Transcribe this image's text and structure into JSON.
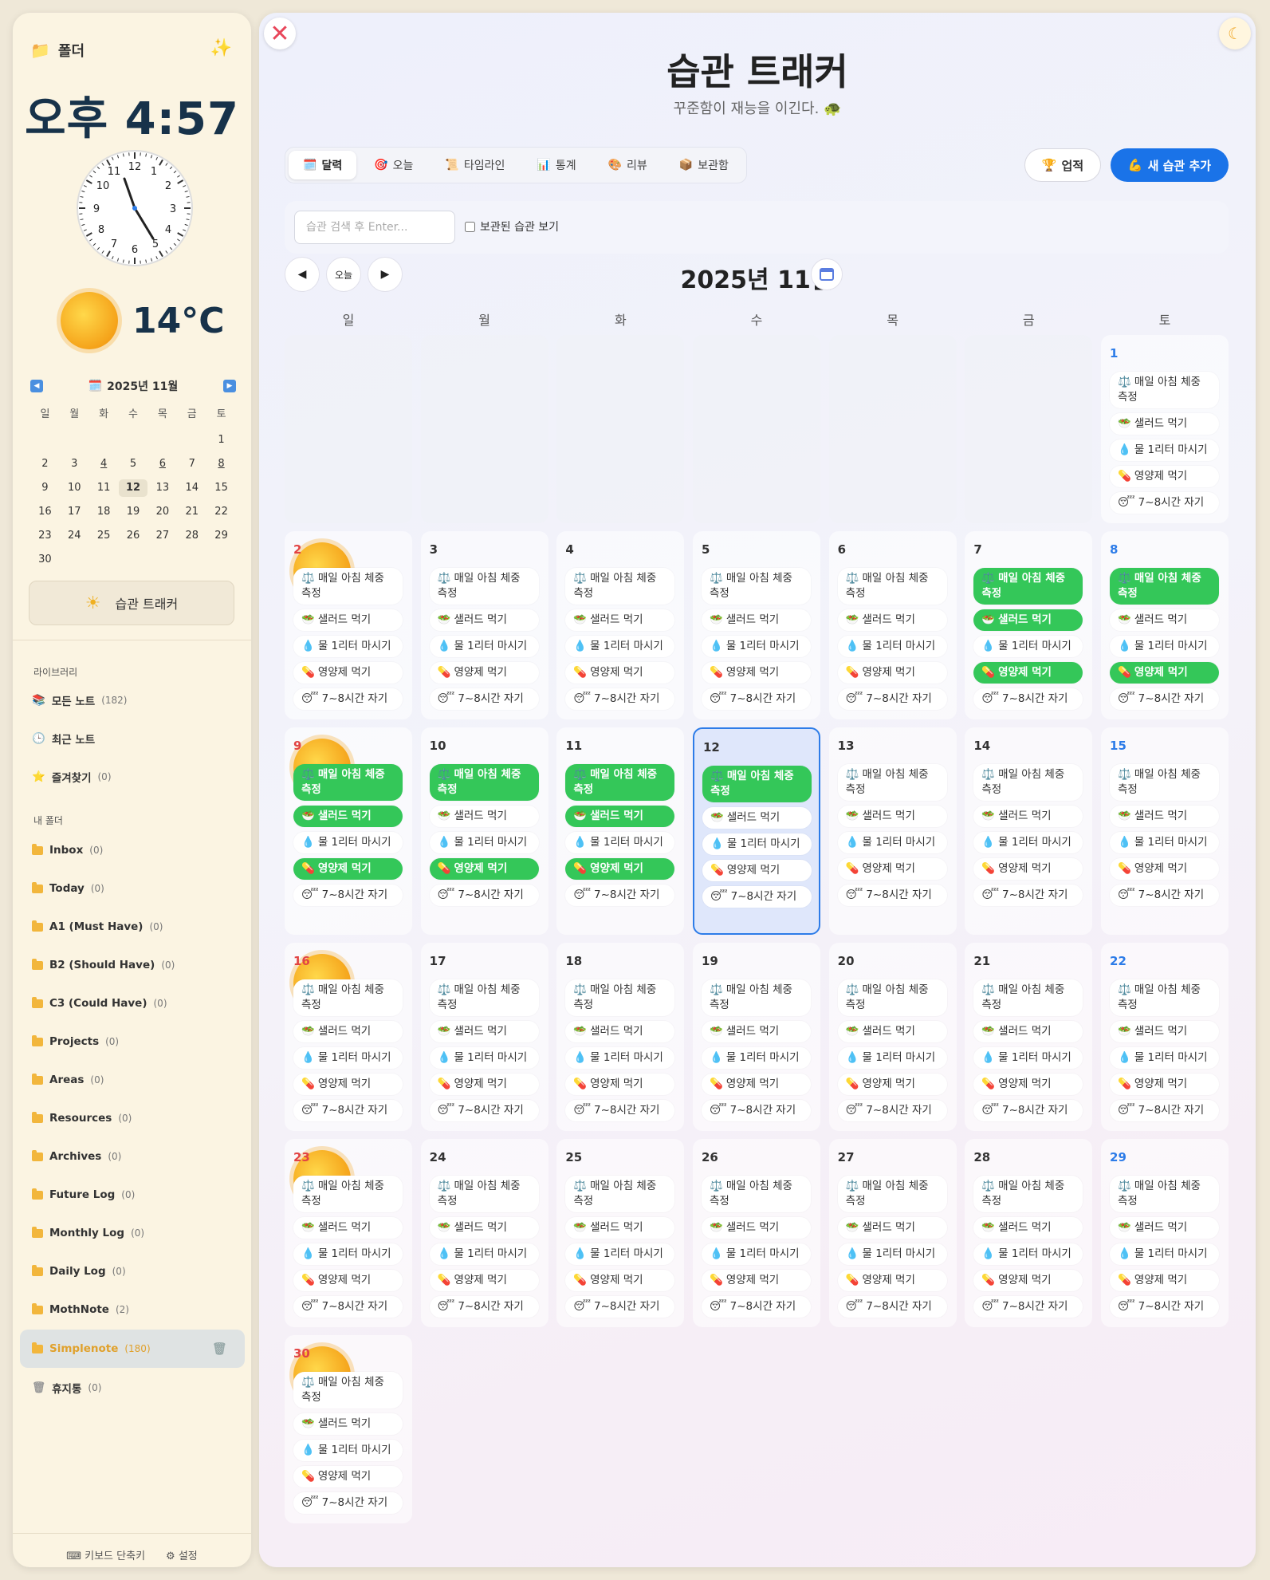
{
  "sidebar": {
    "title": "폴더",
    "time": "오후 4:57",
    "temperature": "14°C",
    "mini_calendar": {
      "title": "2025년 11월",
      "weekdays": [
        "일",
        "월",
        "화",
        "수",
        "목",
        "금",
        "토"
      ],
      "days": [
        "",
        "",
        "",
        "",
        "",
        "",
        "1",
        "2",
        "3",
        "4",
        "5",
        "6",
        "7",
        "8",
        "9",
        "10",
        "11",
        "12",
        "13",
        "14",
        "15",
        "16",
        "17",
        "18",
        "19",
        "20",
        "21",
        "22",
        "23",
        "24",
        "25",
        "26",
        "27",
        "28",
        "29",
        "30"
      ],
      "today": "12",
      "underlined": [
        "4",
        "6",
        "8"
      ]
    },
    "tracker_button": "습관 트래커",
    "library_label": "라이브러리",
    "library_items": [
      {
        "label": "모든 노트",
        "count": "(182)",
        "icon": "notes-icon"
      },
      {
        "label": "최근 노트",
        "count": "",
        "icon": "clock-icon"
      },
      {
        "label": "즐겨찾기",
        "count": "(0)",
        "icon": "star-icon"
      }
    ],
    "folders_label": "내 폴더",
    "folders": [
      {
        "label": "Inbox",
        "count": "(0)"
      },
      {
        "label": "Today",
        "count": "(0)"
      },
      {
        "label": "A1 (Must Have)",
        "count": "(0)"
      },
      {
        "label": "B2 (Should Have)",
        "count": "(0)"
      },
      {
        "label": "C3 (Could Have)",
        "count": "(0)"
      },
      {
        "label": "Projects",
        "count": "(0)"
      },
      {
        "label": "Areas",
        "count": "(0)"
      },
      {
        "label": "Resources",
        "count": "(0)"
      },
      {
        "label": "Archives",
        "count": "(0)"
      },
      {
        "label": "Future Log",
        "count": "(0)"
      },
      {
        "label": "Monthly Log",
        "count": "(0)"
      },
      {
        "label": "Daily Log",
        "count": "(0)"
      },
      {
        "label": "MothNote",
        "count": "(2)"
      },
      {
        "label": "Simplenote",
        "count": "(180)"
      }
    ],
    "trash": {
      "label": "휴지통",
      "count": "(0)"
    },
    "footer": {
      "shortcuts": "키보드 단축키",
      "settings": "설정"
    }
  },
  "main": {
    "title": "습관 트래커",
    "subtitle": "꾸준함이 재능을 이긴다. 🐢",
    "tabs": [
      {
        "label": "달력",
        "icon": "calendar-icon"
      },
      {
        "label": "오늘",
        "icon": "target-icon"
      },
      {
        "label": "타임라인",
        "icon": "scroll-icon"
      },
      {
        "label": "통계",
        "icon": "chart-icon"
      },
      {
        "label": "리뷰",
        "icon": "palette-icon"
      },
      {
        "label": "보관함",
        "icon": "box-icon"
      }
    ],
    "achievements_button": "업적",
    "add_button": "새 습관 추가",
    "search_placeholder": "습관 검색 후 Enter...",
    "archived_checkbox": "보관된 습관 보기",
    "today_button": "오늘",
    "month_title": "2025년 11월",
    "weekdays": [
      "일",
      "월",
      "화",
      "수",
      "목",
      "금",
      "토"
    ],
    "habits": [
      {
        "label": "매일 아침 체중 측정",
        "icon": "⚖️"
      },
      {
        "label": "샐러드 먹기",
        "icon": "🥗"
      },
      {
        "label": "물 1리터 마시기",
        "icon": "💧"
      },
      {
        "label": "영양제 먹기",
        "icon": "💊"
      },
      {
        "label": "7~8시간 자기",
        "icon": "😴"
      }
    ],
    "today_day": 12,
    "completed": {
      "7": [
        0,
        1,
        3
      ],
      "8": [
        0,
        3
      ],
      "9": [
        0,
        1,
        3
      ],
      "10": [
        0,
        3
      ],
      "11": [
        0,
        1,
        3
      ],
      "12": [
        0
      ]
    }
  },
  "colors": {
    "accent": "#1a73e8",
    "done": "#34c759",
    "sunday": "#e24444",
    "saturday": "#2d7ce8"
  }
}
